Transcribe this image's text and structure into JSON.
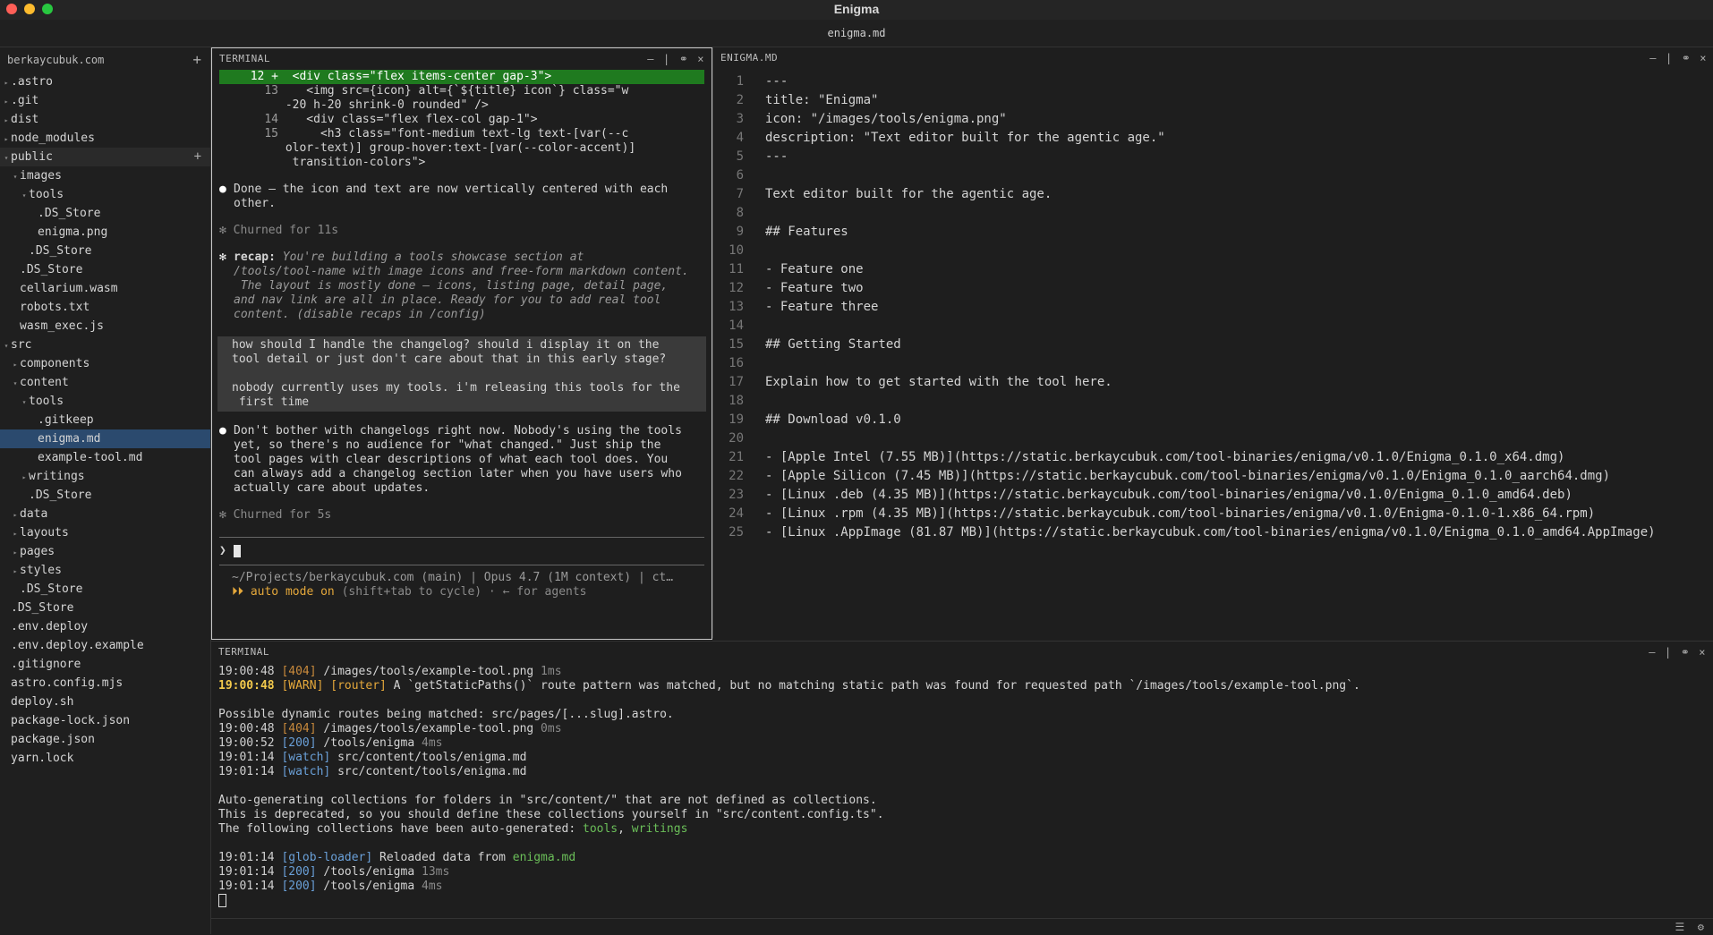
{
  "window": {
    "title": "Enigma",
    "tab": "enigma.md"
  },
  "sidebar": {
    "root": "berkaycubuk.com",
    "add": "+",
    "items": [
      {
        "label": ".astro",
        "depth": 0,
        "caret": "▸"
      },
      {
        "label": ".git",
        "depth": 0,
        "caret": "▸"
      },
      {
        "label": "dist",
        "depth": 0,
        "caret": "▸"
      },
      {
        "label": "node_modules",
        "depth": 0,
        "caret": "▸"
      },
      {
        "label": "public",
        "depth": 0,
        "caret": "▾",
        "plus": "+"
      },
      {
        "label": "images",
        "depth": 1,
        "caret": "▾"
      },
      {
        "label": "tools",
        "depth": 2,
        "caret": "▾"
      },
      {
        "label": ".DS_Store",
        "depth": 3,
        "caret": ""
      },
      {
        "label": "enigma.png",
        "depth": 3,
        "caret": ""
      },
      {
        "label": ".DS_Store",
        "depth": 2,
        "caret": ""
      },
      {
        "label": ".DS_Store",
        "depth": 1,
        "caret": ""
      },
      {
        "label": "cellarium.wasm",
        "depth": 1,
        "caret": ""
      },
      {
        "label": "robots.txt",
        "depth": 1,
        "caret": ""
      },
      {
        "label": "wasm_exec.js",
        "depth": 1,
        "caret": ""
      },
      {
        "label": "src",
        "depth": 0,
        "caret": "▾"
      },
      {
        "label": "components",
        "depth": 1,
        "caret": "▸"
      },
      {
        "label": "content",
        "depth": 1,
        "caret": "▾"
      },
      {
        "label": "tools",
        "depth": 2,
        "caret": "▾"
      },
      {
        "label": ".gitkeep",
        "depth": 3,
        "caret": ""
      },
      {
        "label": "enigma.md",
        "depth": 3,
        "caret": "",
        "selected": true
      },
      {
        "label": "example-tool.md",
        "depth": 3,
        "caret": ""
      },
      {
        "label": "writings",
        "depth": 2,
        "caret": "▸"
      },
      {
        "label": ".DS_Store",
        "depth": 2,
        "caret": ""
      },
      {
        "label": "data",
        "depth": 1,
        "caret": "▸"
      },
      {
        "label": "layouts",
        "depth": 1,
        "caret": "▸"
      },
      {
        "label": "pages",
        "depth": 1,
        "caret": "▸"
      },
      {
        "label": "styles",
        "depth": 1,
        "caret": "▸"
      },
      {
        "label": ".DS_Store",
        "depth": 1,
        "caret": ""
      },
      {
        "label": ".DS_Store",
        "depth": 0,
        "caret": ""
      },
      {
        "label": ".env.deploy",
        "depth": 0,
        "caret": ""
      },
      {
        "label": ".env.deploy.example",
        "depth": 0,
        "caret": ""
      },
      {
        "label": ".gitignore",
        "depth": 0,
        "caret": ""
      },
      {
        "label": "astro.config.mjs",
        "depth": 0,
        "caret": ""
      },
      {
        "label": "deploy.sh",
        "depth": 0,
        "caret": ""
      },
      {
        "label": "package-lock.json",
        "depth": 0,
        "caret": ""
      },
      {
        "label": "package.json",
        "depth": 0,
        "caret": ""
      },
      {
        "label": "yarn.lock",
        "depth": 0,
        "caret": ""
      }
    ]
  },
  "claude": {
    "header": "TERMINAL",
    "controls": [
      "—",
      "|",
      "⚭",
      "×"
    ],
    "diff": [
      {
        "num": "12 +",
        "text": "  <div class=\"flex items-center gap-3\">",
        "added": true
      },
      {
        "num": "13",
        "text": "    <img src={icon} alt={`${title} icon`} class=\"w",
        "added": false
      },
      {
        "num": "",
        "text": " -20 h-20 shrink-0 rounded\" />",
        "added": false
      },
      {
        "num": "14",
        "text": "    <div class=\"flex flex-col gap-1\">",
        "added": false
      },
      {
        "num": "15",
        "text": "      <h3 class=\"font-medium text-lg text-[var(--c",
        "added": false
      },
      {
        "num": "",
        "text": " olor-text)] group-hover:text-[var(--color-accent)]",
        "added": false
      },
      {
        "num": "",
        "text": "  transition-colors\">",
        "added": false
      }
    ],
    "done_msg": "Done — the icon and text are now vertically centered with each\nother.",
    "churn1": "✻ Churned for 11s",
    "recap_label": "recap:",
    "recap_text": "You're building a tools showcase section at\n/tools/tool-name with image icons and free-form markdown content.\n The layout is mostly done — icons, listing page, detail page,\nand nav link are all in place. Ready for you to add real tool\ncontent. (disable recaps in /config)",
    "user_msg": "how should I handle the changelog? should i display it on the\ntool detail or just don't care about that in this early stage?\n\nnobody currently uses my tools. i'm releasing this tools for the\n first time",
    "reply": "Don't bother with changelogs right now. Nobody's using the tools\nyet, so there's no audience for \"what changed.\" Just ship the\ntool pages with clear descriptions of what each tool does. You\ncan always add a changelog section later when you have users who\nactually care about updates.",
    "churn2": "✻ Churned for 5s",
    "prompt": "❯",
    "status_path": "~/Projects/berkaycubuk.com (main) | Opus 4.7 (1M context) | ct…",
    "auto_mode": "⏵⏵ auto mode on",
    "auto_hint": " (shift+tab to cycle) · ← for agents"
  },
  "editor": {
    "header": "ENIGMA.MD",
    "lines": [
      "---",
      "title: \"Enigma\"",
      "icon: \"/images/tools/enigma.png\"",
      "description: \"Text editor built for the agentic age.\"",
      "---",
      "",
      "Text editor built for the agentic age.",
      "",
      "## Features",
      "",
      "- Feature one",
      "- Feature two",
      "- Feature three",
      "",
      "## Getting Started",
      "",
      "Explain how to get started with the tool here.",
      "",
      "## Download v0.1.0",
      "",
      "- [Apple Intel (7.55 MB)](https://static.berkaycubuk.com/tool-binaries/enigma/v0.1.0/Enigma_0.1.0_x64.dmg)",
      "- [Apple Silicon (7.45 MB)](https://static.berkaycubuk.com/tool-binaries/enigma/v0.1.0/Enigma_0.1.0_aarch64.dmg)",
      "- [Linux .deb (4.35 MB)](https://static.berkaycubuk.com/tool-binaries/enigma/v0.1.0/Enigma_0.1.0_amd64.deb)",
      "- [Linux .rpm (4.35 MB)](https://static.berkaycubuk.com/tool-binaries/enigma/v0.1.0/Enigma-0.1.0-1.x86_64.rpm)",
      "- [Linux .AppImage (81.87 MB)](https://static.berkaycubuk.com/tool-binaries/enigma/v0.1.0/Enigma_0.1.0_amd64.AppImage)"
    ]
  },
  "terminal": {
    "header": "TERMINAL",
    "lines": [
      [
        {
          "t": "19:00:48 ",
          "c": "ts"
        },
        {
          "t": "[404]",
          "c": "tag-404"
        },
        {
          "t": " /images/tools/example-tool.png ",
          "c": ""
        },
        {
          "t": "1ms",
          "c": "dim"
        }
      ],
      [
        {
          "t": "19:00:48 ",
          "c": "ts-b"
        },
        {
          "t": "[WARN] [router]",
          "c": "tag-warn"
        },
        {
          "t": " A `getStaticPaths()` route pattern was matched, but no matching static path was found for requested path `/images/tools/example-tool.png`.",
          "c": ""
        }
      ],
      [
        {
          "t": "",
          "c": ""
        }
      ],
      [
        {
          "t": "Possible dynamic routes being matched: src/pages/[...slug].astro.",
          "c": ""
        }
      ],
      [
        {
          "t": "19:00:48 ",
          "c": "ts"
        },
        {
          "t": "[404]",
          "c": "tag-404"
        },
        {
          "t": " /images/tools/example-tool.png ",
          "c": ""
        },
        {
          "t": "0ms",
          "c": "dim"
        }
      ],
      [
        {
          "t": "19:00:52 ",
          "c": "ts"
        },
        {
          "t": "[200]",
          "c": "tag-200"
        },
        {
          "t": " /tools/enigma ",
          "c": ""
        },
        {
          "t": "4ms",
          "c": "dim"
        }
      ],
      [
        {
          "t": "19:01:14 ",
          "c": "ts"
        },
        {
          "t": "[watch]",
          "c": "tag-watch"
        },
        {
          "t": " src/content/tools/enigma.md",
          "c": ""
        }
      ],
      [
        {
          "t": "19:01:14 ",
          "c": "ts"
        },
        {
          "t": "[watch]",
          "c": "tag-watch"
        },
        {
          "t": " src/content/tools/enigma.md",
          "c": ""
        }
      ],
      [
        {
          "t": "",
          "c": ""
        }
      ],
      [
        {
          "t": "Auto-generating collections for folders in \"src/content/\" that are not defined as collections.",
          "c": ""
        }
      ],
      [
        {
          "t": "This is deprecated, so you should define these collections yourself in \"src/content.config.ts\".",
          "c": ""
        }
      ],
      [
        {
          "t": "The following collections have been auto-generated: ",
          "c": ""
        },
        {
          "t": "tools",
          "c": "grn"
        },
        {
          "t": ", ",
          "c": ""
        },
        {
          "t": "writings",
          "c": "grn"
        }
      ],
      [
        {
          "t": "",
          "c": ""
        }
      ],
      [
        {
          "t": "19:01:14 ",
          "c": "ts"
        },
        {
          "t": "[glob-loader]",
          "c": "tag-glob"
        },
        {
          "t": " Reloaded data from ",
          "c": ""
        },
        {
          "t": "enigma.md",
          "c": "grn"
        }
      ],
      [
        {
          "t": "19:01:14 ",
          "c": "ts"
        },
        {
          "t": "[200]",
          "c": "tag-200"
        },
        {
          "t": " /tools/enigma ",
          "c": ""
        },
        {
          "t": "13ms",
          "c": "dim"
        }
      ],
      [
        {
          "t": "19:01:14 ",
          "c": "ts"
        },
        {
          "t": "[200]",
          "c": "tag-200"
        },
        {
          "t": " /tools/enigma ",
          "c": ""
        },
        {
          "t": "4ms",
          "c": "dim"
        }
      ]
    ]
  },
  "statusbar": {
    "icons": [
      "list-icon",
      "gear-icon"
    ],
    "glyphs": [
      "☰",
      "⚙"
    ]
  }
}
